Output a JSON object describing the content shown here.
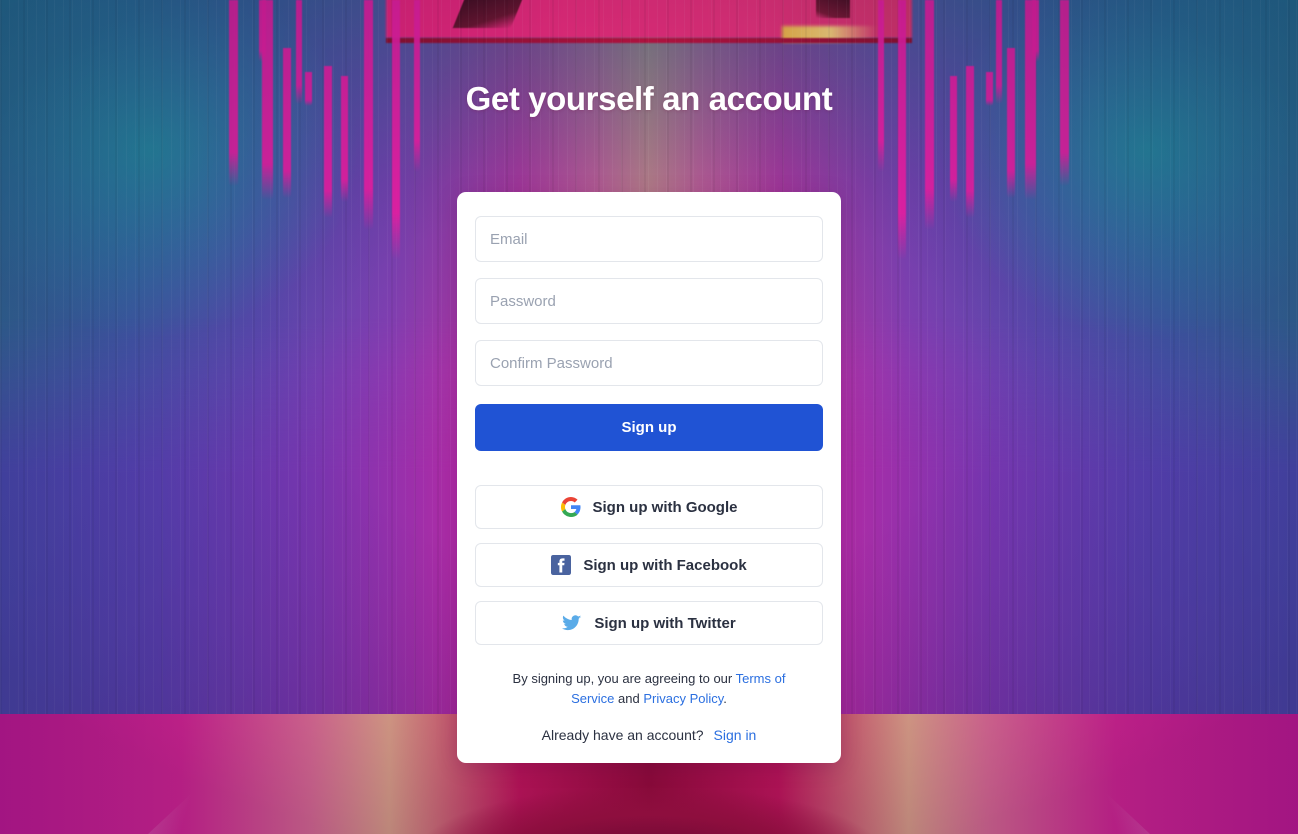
{
  "heading": "Get yourself an account",
  "form": {
    "email_placeholder": "Email",
    "password_placeholder": "Password",
    "confirm_password_placeholder": "Confirm Password",
    "email_value": "",
    "password_value": "",
    "confirm_password_value": "",
    "submit_label": "Sign up"
  },
  "social": {
    "google": {
      "label": "Sign up with Google",
      "icon": "google-icon"
    },
    "facebook": {
      "label": "Sign up with Facebook",
      "icon": "facebook-icon"
    },
    "twitter": {
      "label": "Sign up with Twitter",
      "icon": "twitter-icon"
    }
  },
  "legal": {
    "intro": "By signing up, you are agreeing to our ",
    "terms_label": "Terms of Service",
    "conjunction": " and ",
    "privacy_label": "Privacy Policy",
    "period": "."
  },
  "signin": {
    "prompt": "Already have an account?",
    "link_label": "Sign in"
  },
  "colors": {
    "primary_button": "#2053d4",
    "link": "#2b6fe0",
    "card_background": "#ffffff",
    "heading_text": "#ffffff",
    "placeholder_text": "#9aa2b1",
    "body_text": "#2b3141",
    "google_red": "#ea4335",
    "google_blue": "#4285f4",
    "google_yellow": "#fbbc05",
    "google_green": "#34a853",
    "facebook_blue": "#4a639f",
    "twitter_blue": "#5aabe8"
  }
}
